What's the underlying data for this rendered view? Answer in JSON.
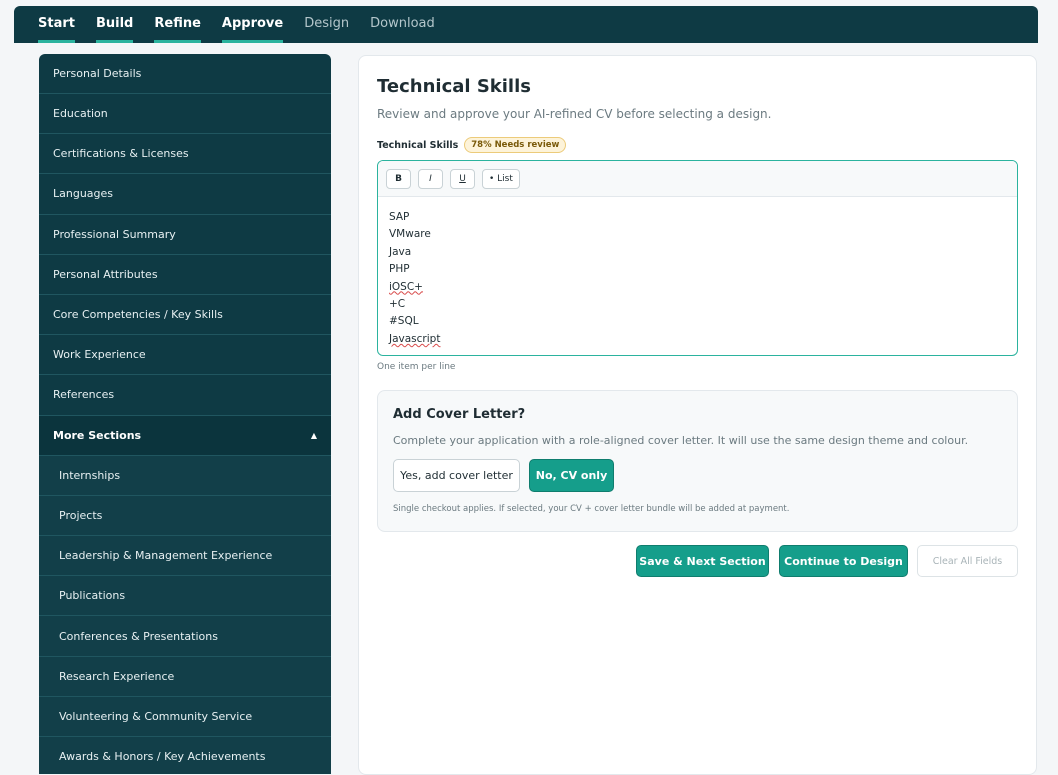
{
  "nav": {
    "tabs": [
      {
        "label": "Start"
      },
      {
        "label": "Build"
      },
      {
        "label": "Refine"
      },
      {
        "label": "Approve"
      },
      {
        "label": "Design"
      },
      {
        "label": "Download"
      }
    ]
  },
  "sidebar": {
    "items": [
      "Personal Details",
      "Education",
      "Certifications & Licenses",
      "Languages",
      "Professional Summary",
      "Personal Attributes",
      "Core Competencies / Key Skills",
      "Work Experience",
      "References"
    ],
    "more_label": "More Sections",
    "more_items": [
      "Internships",
      "Projects",
      "Leadership & Management Experience",
      "Publications",
      "Conferences & Presentations",
      "Research Experience",
      "Volunteering & Community Service",
      "Awards & Honors / Key Achievements"
    ]
  },
  "main": {
    "title": "Technical Skills",
    "intro": "Review and approve your AI-refined CV before selecting a design.",
    "field_label": "Technical Skills",
    "badge": "78% Needs review",
    "toolbar": {
      "bold": "B",
      "italic": "I",
      "underline": "U",
      "list": "• List"
    },
    "skills": [
      "SAP",
      "VMware",
      "Java",
      "PHP",
      "iOSC+",
      "+C",
      "#SQL",
      "Javascript"
    ],
    "hint": "One item per line"
  },
  "cover_letter": {
    "title": "Add Cover Letter?",
    "description": "Complete your application with a role-aligned cover letter. It will use the same design theme and colour.",
    "yes_label": "Yes, add cover letter",
    "no_label": "No, CV only",
    "note": "Single checkout applies. If selected, your CV + cover letter bundle will be added at payment."
  },
  "actions": {
    "save_next": "Save & Next Section",
    "continue": "Continue to Design",
    "clear": "Clear All Fields"
  }
}
